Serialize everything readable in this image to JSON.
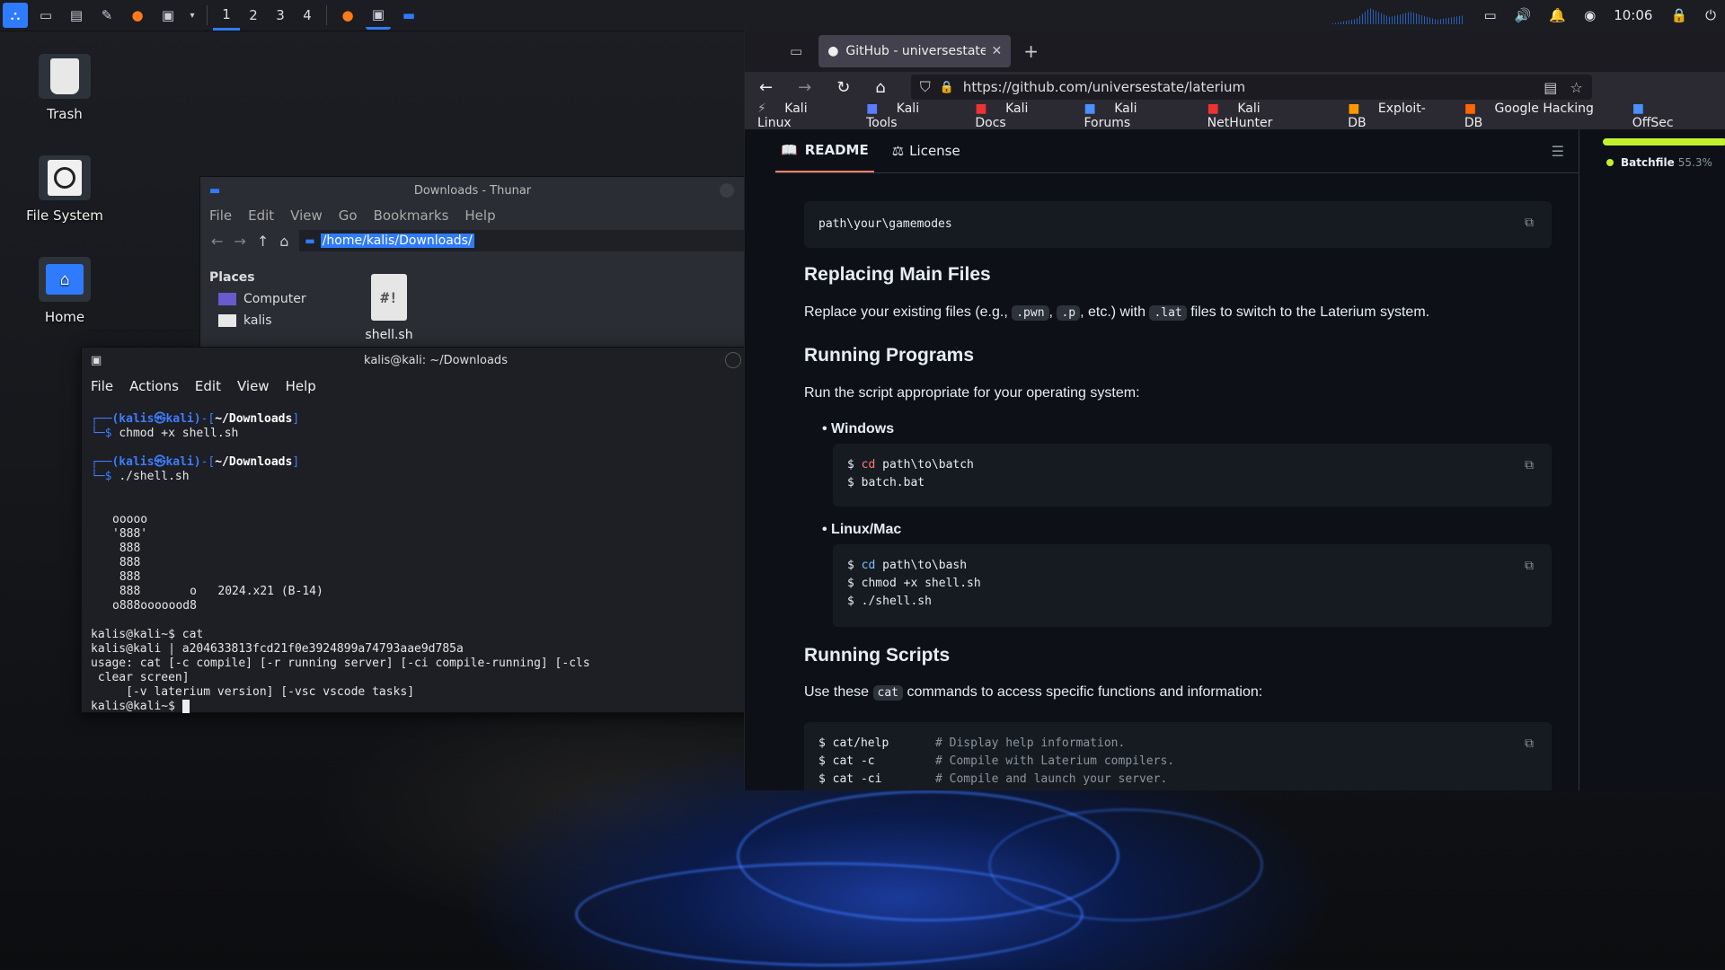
{
  "panel": {
    "workspaces": [
      "1",
      "2",
      "3",
      "4"
    ],
    "clock": "10:06"
  },
  "desktop": {
    "icons": [
      {
        "label": "Trash"
      },
      {
        "label": "File System"
      },
      {
        "label": "Home"
      }
    ]
  },
  "thunar": {
    "title": "Downloads - Thunar",
    "menu": [
      "File",
      "Edit",
      "View",
      "Go",
      "Bookmarks",
      "Help"
    ],
    "path": "/home/kalis/Downloads/",
    "places_label": "Places",
    "places": [
      "Computer",
      "kalis"
    ],
    "file_name": "shell.sh",
    "file_icon_glyph": "#!"
  },
  "terminal": {
    "title": "kalis@kali: ~/Downloads",
    "menu": [
      "File",
      "Actions",
      "Edit",
      "View",
      "Help"
    ],
    "prompt_user": "(kalis㉿kali)",
    "prompt_dir": "~/Downloads",
    "cmd1": "chmod +x shell.sh",
    "cmd2": "./shell.sh",
    "banner": [
      "ooooo",
      "'888'",
      " 888",
      " 888",
      " 888",
      " 888       o   2024.x21 (B-14)",
      "o888ooooood8"
    ],
    "out1": "kalis@kali~$ cat",
    "out2": "kalis@kali | a204633813fcd21f0e3924899a74793aae9d785a",
    "out3": "usage: cat [-c compile] [-r running server] [-ci compile-running] [-cls",
    "out4": " clear screen]",
    "out5": "     [-v laterium version] [-vsc vscode tasks]",
    "out6": "kalis@kali~$"
  },
  "browser": {
    "tab_title": "GitHub - universestate/laterium",
    "url": "https://github.com/universestate/laterium",
    "bookmarks": [
      "Kali Linux",
      "Kali Tools",
      "Kali Docs",
      "Kali Forums",
      "Kali NetHunter",
      "Exploit-DB",
      "Google Hacking DB",
      "OffSec"
    ],
    "readme_tab": "README",
    "license_tab": "License",
    "sidebar_lang": "Batchfile",
    "sidebar_pct": "55.3%",
    "code1": "path\\your\\gamemodes",
    "h_replacing": "Replacing Main Files",
    "p_replacing_a": "Replace your existing files (e.g.,",
    "p_replacing_code1": ".pwn",
    "p_replacing_code2": ".p",
    "p_replacing_b": ", etc.) with",
    "p_replacing_code3": ".lat",
    "p_replacing_c": "files to switch to the Laterium system.",
    "h_running_programs": "Running Programs",
    "p_running_programs": "Run the script appropriate for your operating system:",
    "li_windows": "Windows",
    "win_line1_cmd": "cd",
    "win_line1_arg": "path\\to\\batch",
    "win_line2": "batch.bat",
    "li_linux": "Linux/Mac",
    "lin_line1_cmd": "cd",
    "lin_line1_arg": "path\\to\\bash",
    "lin_line2": "chmod +x shell.sh",
    "lin_line3": "./shell.sh",
    "h_running_scripts": "Running Scripts",
    "p_scripts_a": "Use these",
    "p_scripts_code": "cat",
    "p_scripts_b": "commands to access specific functions and information:",
    "scripts": [
      {
        "cmd": "$ cat/help",
        "comment": "# Display help information."
      },
      {
        "cmd": "$ cat -c",
        "comment": "# Compile with Laterium compilers."
      },
      {
        "cmd": "$ cat -ci",
        "comment": "# Compile and launch your server."
      }
    ]
  },
  "colors": {
    "accent": "#2f7bff",
    "github_bg": "#0d1117",
    "batch_dot": "#c1f12e"
  }
}
